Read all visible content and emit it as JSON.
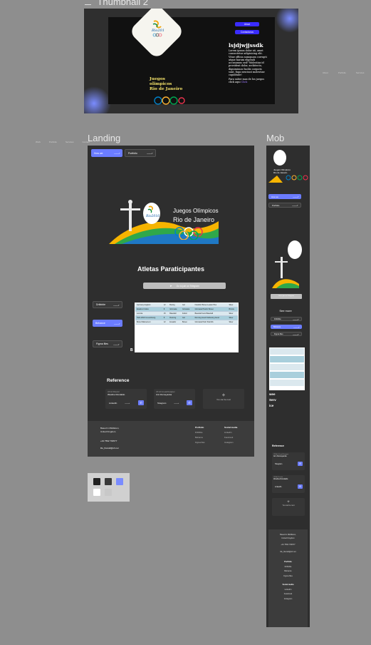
{
  "frames": {
    "thumbnail_label": "Thumbnail 2",
    "landing_label": "Landing",
    "mob_label": "Mob"
  },
  "thumbnail": {
    "btn_about": "About",
    "btn_contact": "Contactanos",
    "heading": "lsjdjwjjssdk",
    "body": "Lorem ipsum dolor sit, amet consectetur adipisicing elit. Vitae officia numquam corrupti atque harum eligendi accusamus sed? Molestias id provident dolor, architecto, dignissimos facilis corporis sunt, fuga nesciunt molestiae cupiditate!",
    "more_text": "Para saber mas de los juegos click aqui",
    "more_link": "Click",
    "title_line1": "Juegos",
    "title_line2": "olimpicos",
    "title_line3": "Rio de Janeiro",
    "right_links": [
      "About",
      "Portfolio",
      "Services",
      "Co"
    ]
  },
  "landing_nav_small": [
    "Work",
    "Portfolio",
    "Services",
    "Contact"
  ],
  "landing": {
    "nav": [
      {
        "label": "How we",
        "active": true
      },
      {
        "label": "Portfolio",
        "active": false
      }
    ],
    "hero_title_line1": "Juegos Olímpicos",
    "hero_title_line2": "Rio de Janeiro",
    "section_title": "Atletas Paraticipantes",
    "telegram_btn": "Go to join on Telegram",
    "side_buttons": [
      {
        "label": "Dribbble",
        "active": false
      },
      {
        "label": "Behance",
        "active": true
      },
      {
        "label": "Figma files",
        "active": false
      }
    ],
    "side_letter": "B",
    "table_rows": [
      [
        "Germany kingdom",
        "12",
        "Boxing",
        "Gol",
        "Frankfurt Boxeo Leader Plus",
        "Silver"
      ],
      [
        "Estados Unidos",
        "8",
        "Gimnasia",
        "Gimnasia",
        "Gimnasia Historic Boxeo",
        "Bronze"
      ],
      [
        "Los Isla",
        "15",
        "Baseball",
        "Futbol",
        "Baseball Good Baseball",
        "Silver"
      ],
      [
        "Hello World Luxembourg",
        "8",
        "Running",
        "Gol",
        "Running Good Kickboxing Good",
        "Silver"
      ],
      [
        "Bona Villarreal ext",
        "12",
        "Ecuador",
        "Boxeo",
        "Gimnasia Hello Total We",
        "Silver"
      ]
    ],
    "reference_title": "Reference",
    "references": [
      {
        "role": "UX Art Director",
        "name": "Wesline Rondaldo",
        "link": "LinkedIn"
      },
      {
        "role": "UX Art & Lead Designer",
        "name": "Ann Demeyanka",
        "link": "Telegram"
      }
    ],
    "add_more": "You can be next",
    "footer": {
      "location_line1": "Based in Middleton,",
      "location_line2": "United Kingdom",
      "phone": "+44 7562 764577",
      "email": "life_fluxrafi@sh.net",
      "portfolio_title": "Portfolio",
      "portfolio_items": [
        "Dribbble",
        "Behance",
        "Figma files"
      ],
      "social_title": "Social media",
      "social_items": [
        "LinkedIn",
        "Facebook",
        "Instagram"
      ]
    }
  },
  "mob": {
    "hero_line1": "Juegos Olímpicos",
    "hero_line2": "Rio de Janeiro",
    "nav": [
      {
        "label": "How we",
        "active": true
      },
      {
        "label": "Portfolio",
        "active": false
      }
    ],
    "telegram_btn": "Go to join on Telegram",
    "see_more": "See more",
    "buttons": [
      {
        "label": "Dribbble",
        "active": false
      },
      {
        "label": "Behance",
        "active": true
      },
      {
        "label": "Figma files",
        "active": false
      }
    ],
    "side_text": [
      "wee",
      "Serv",
      "ice"
    ],
    "reference_title": "Reference",
    "references": [
      {
        "role": "UX Art & Lead Designer",
        "name": "Ann Demeyanka",
        "link": "Telegram"
      },
      {
        "role": "UX Art Director",
        "name": "Wesline Rondaldo",
        "link": "LinkedIn"
      }
    ],
    "add_more": "You can be next",
    "footer": {
      "location_line1": "Based in Middleton,",
      "location_line2": "United Kingdom",
      "phone": "+44 7562 764577",
      "email": "life_fluxrafi@sh.net",
      "portfolio_title": "Portfolio",
      "portfolio_items": [
        "Dribbble",
        "Behance",
        "Figma files"
      ],
      "social_title": "Social media",
      "social_items": [
        "LinkedIn",
        "Facebook",
        "Instagram"
      ]
    }
  },
  "colors": {
    "canvas": "#8e8e8e",
    "frame_dark": "#2e2e2e",
    "accent": "#6b7cff",
    "button_blue": "#3a2cff",
    "gold": "#f5e36a"
  },
  "swatches": [
    "#222222",
    "#3a3a3a",
    "#7a8cff",
    "#ffffff",
    "#c8c8c8"
  ]
}
